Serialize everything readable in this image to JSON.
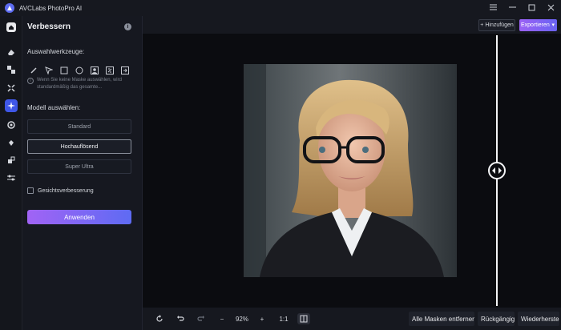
{
  "app": {
    "title": "AVCLabs PhotoPro AI",
    "window_controls": [
      "menu-icon",
      "minimize-icon",
      "maximize-icon",
      "close-icon"
    ]
  },
  "rail": {
    "icons": [
      "home-icon",
      "eraser-icon",
      "replace-icon",
      "expand-icon",
      "enhance-icon",
      "background-icon",
      "colorize-icon",
      "crop-icon",
      "adjust-icon"
    ],
    "active_index": 4
  },
  "panel": {
    "title": "Verbessern",
    "selection_tools_label": "Auswahlwerkzeuge:",
    "tools": [
      "brush-icon",
      "pointer-icon",
      "rectangle-icon",
      "ellipse-icon",
      "portrait-icon",
      "ai-select-icon",
      "import-mask-icon"
    ],
    "hint": "Wenn Sie keine Maske auswählen, wird standardmäßig das gesamte...",
    "model_label": "Modell auswählen:",
    "models": [
      "Standard",
      "Hochauflösend",
      "Super Ultra"
    ],
    "selected_model": "Hochauflösend",
    "face_enhance_label": "Gesichtsverbesserung",
    "face_enhance_checked": false,
    "apply_label": "Anwenden"
  },
  "topbar": {
    "add_label": "Hinzufügen",
    "export_label": "Exportieren"
  },
  "bottombar": {
    "zoom": "92%",
    "ratio": "1:1",
    "remove_masks_label": "Alle Masken entfernen",
    "undo_label": "Rückgängig",
    "redo_label": "Wiederherstellen"
  },
  "colors": {
    "accent_blue": "#3f57e8",
    "gradient_start": "#a163f5",
    "gradient_end": "#5e6bf3",
    "background": "#0f1117"
  }
}
